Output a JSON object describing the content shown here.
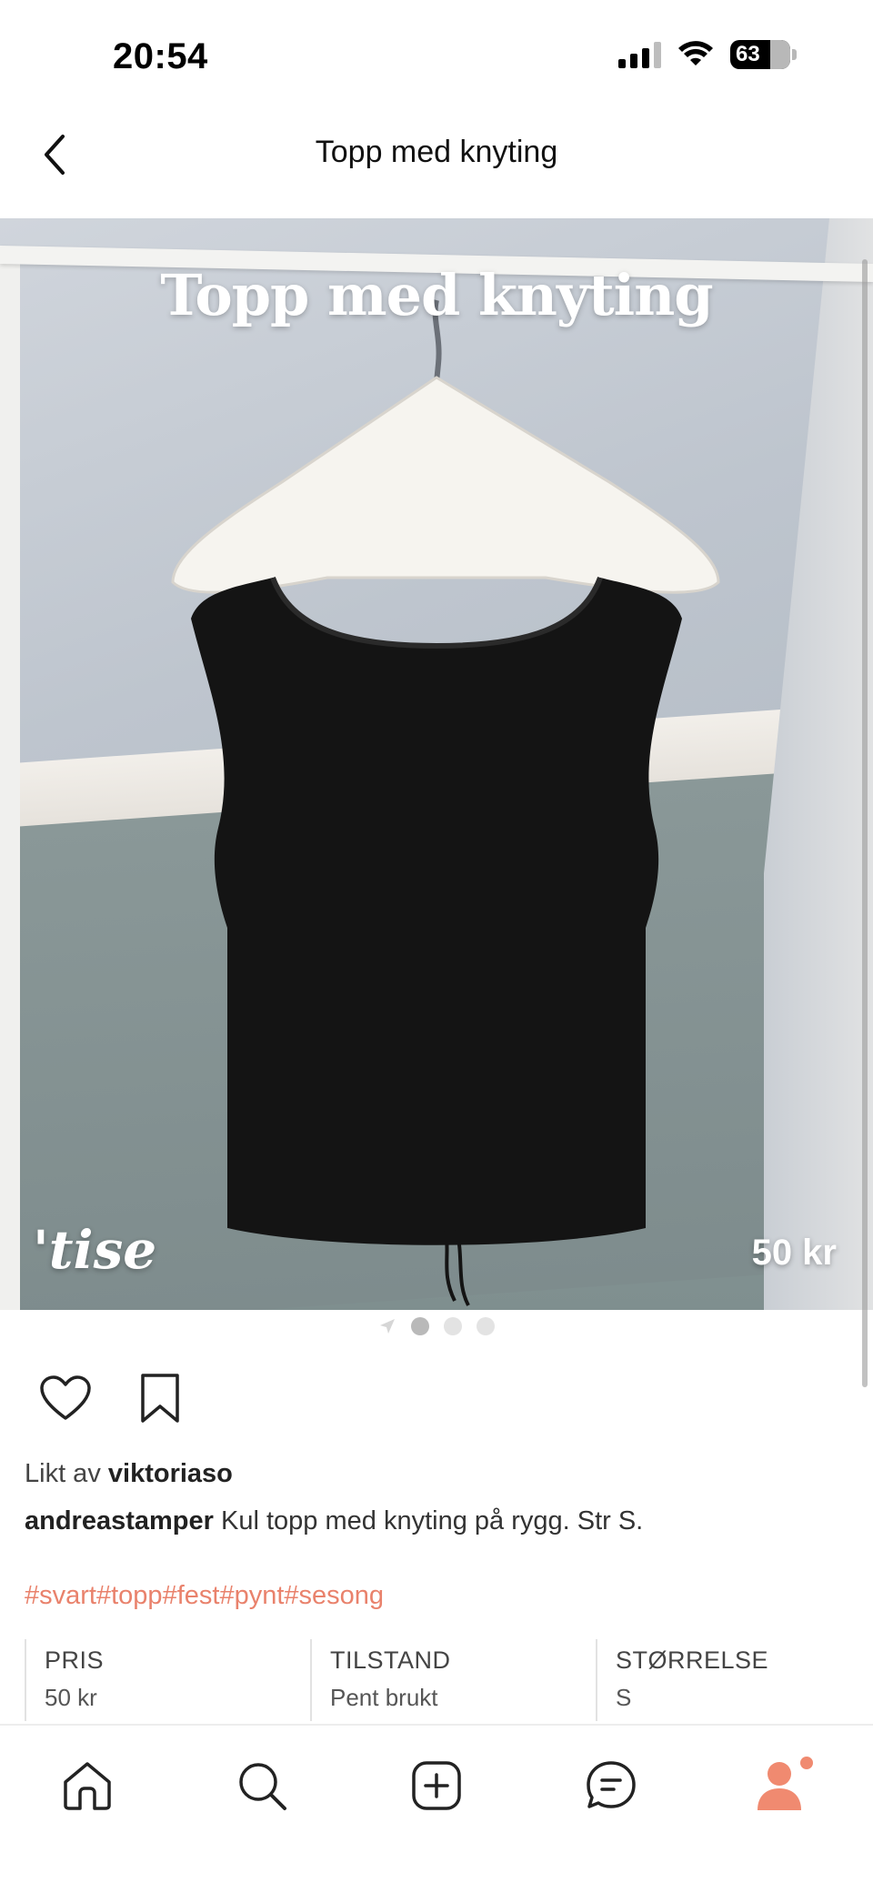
{
  "status_bar": {
    "time": "20:54",
    "battery": "63"
  },
  "header": {
    "title": "Topp med knyting",
    "back_icon": "chevron-left-icon"
  },
  "photo": {
    "overlay_title": "Topp med knyting",
    "brand": "'tise",
    "price": "50 kr"
  },
  "carousel": {
    "count": 3,
    "active_index": 0
  },
  "post": {
    "liked_prefix": "Likt av",
    "liked_user": "viktoriaso",
    "author": "andreastamper",
    "description": "Kul topp med knyting på rygg. Str S.",
    "hashtags": [
      "#svart",
      "#topp",
      "#fest",
      "#pynt",
      "#sesong"
    ]
  },
  "details": [
    {
      "label": "PRIS",
      "value": "50 kr"
    },
    {
      "label": "TILSTAND",
      "value": "Pent brukt"
    },
    {
      "label": "STØRRELSE",
      "value": "S"
    }
  ],
  "bottom_nav": {
    "items": [
      "home-icon",
      "search-icon",
      "add-icon",
      "chat-icon",
      "profile-icon"
    ],
    "accent_color": "#f08a70"
  },
  "colors": {
    "hashtag": "#e9826c",
    "accent": "#f08a70"
  }
}
